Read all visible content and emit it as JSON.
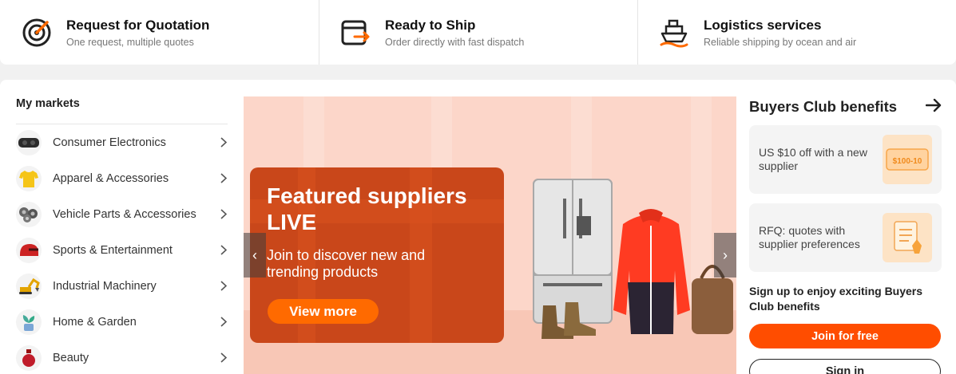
{
  "services": [
    {
      "title": "Request for Quotation",
      "subtitle": "One request, multiple quotes",
      "icon": "target-icon"
    },
    {
      "title": "Ready to Ship",
      "subtitle": "Order directly with fast dispatch",
      "icon": "box-arrow-icon"
    },
    {
      "title": "Logistics services",
      "subtitle": "Reliable shipping by ocean and air",
      "icon": "ship-icon"
    }
  ],
  "markets": {
    "title": "My markets",
    "items": [
      {
        "label": "Consumer Electronics",
        "icon": "vr-headset-icon"
      },
      {
        "label": "Apparel & Accessories",
        "icon": "tshirt-icon"
      },
      {
        "label": "Vehicle Parts & Accessories",
        "icon": "wheels-icon"
      },
      {
        "label": "Sports & Entertainment",
        "icon": "helmet-icon"
      },
      {
        "label": "Industrial Machinery",
        "icon": "excavator-icon"
      },
      {
        "label": "Home & Garden",
        "icon": "plant-icon"
      },
      {
        "label": "Beauty",
        "icon": "perfume-icon"
      }
    ]
  },
  "banner": {
    "title": "Featured suppliers LIVE",
    "subtitle": "Join to discover new and trending products",
    "cta": "View more",
    "prev": "‹",
    "next": "›"
  },
  "club": {
    "title": "Buyers Club benefits",
    "cards": [
      {
        "text": "US $10 off with a new supplier",
        "badge": "$100-10",
        "icon": "coupon-icon"
      },
      {
        "text": "RFQ: quotes with supplier preferences",
        "icon": "checklist-icon"
      }
    ],
    "signup_text": "Sign up to enjoy exciting Buyers Club benefits",
    "join_label": "Join for free",
    "signin_label": "Sign in"
  },
  "colors": {
    "accent": "#ff4d00",
    "cta": "#ff6a00",
    "promo": "#c9471a",
    "banner_bg": "#fcd6c9"
  }
}
